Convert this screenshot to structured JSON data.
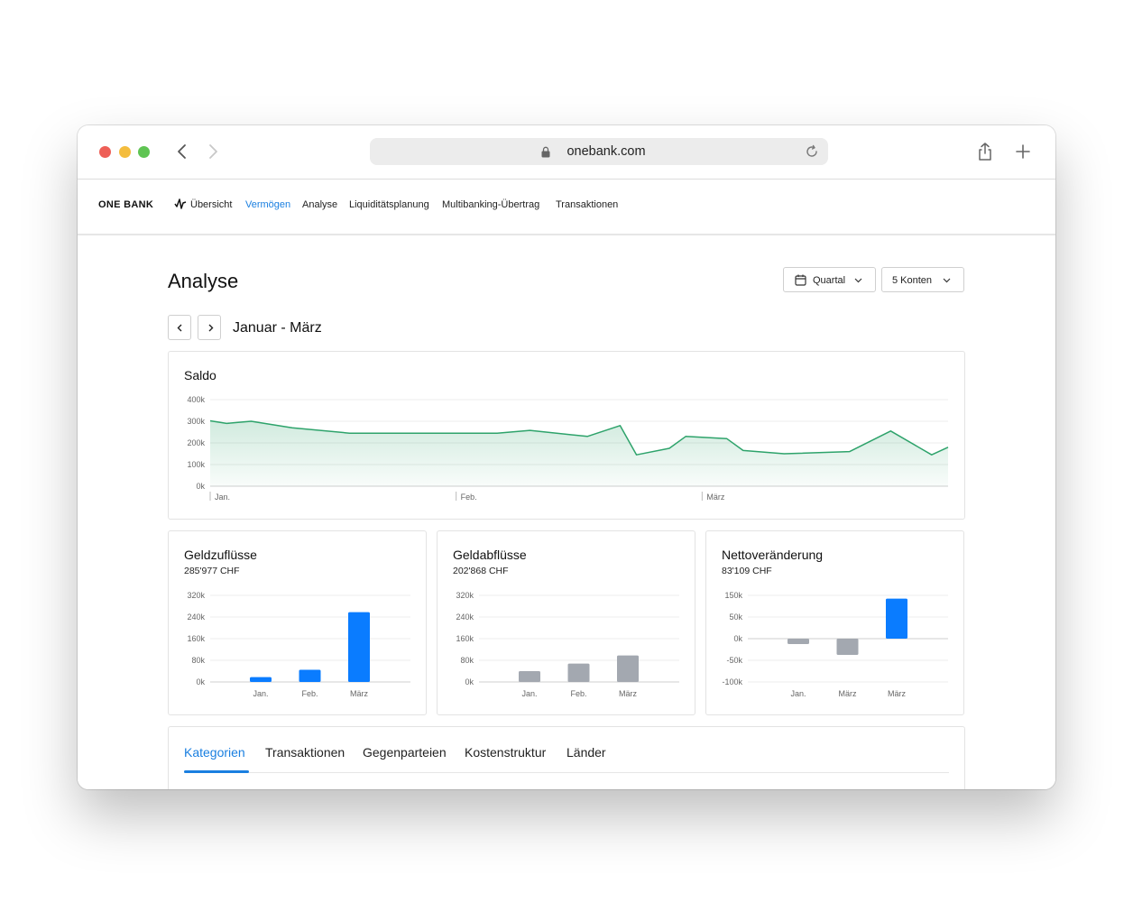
{
  "browser": {
    "url": "onebank.com"
  },
  "app": {
    "logo": "ONE BANK",
    "nav": [
      {
        "label": "Übersicht",
        "active": false
      },
      {
        "label": "Vermögen",
        "active": true
      },
      {
        "label": "Analyse",
        "active": false
      },
      {
        "label": "Liquiditätsplanung",
        "active": false
      },
      {
        "label": "Multibanking-Übertrag",
        "active": false
      },
      {
        "label": "Transaktionen",
        "active": false
      }
    ],
    "accent_color": "#1a7fe0"
  },
  "page": {
    "title": "Analyse",
    "period_dropdown": "Quartal",
    "accounts_dropdown": "5 Konten",
    "period_label": "Januar - März"
  },
  "tabs": [
    {
      "label": "Kategorien",
      "active": true
    },
    {
      "label": "Transaktionen",
      "active": false
    },
    {
      "label": "Gegenparteien",
      "active": false
    },
    {
      "label": "Kostenstruktur",
      "active": false
    },
    {
      "label": "Länder",
      "active": false
    }
  ],
  "chart_data": [
    {
      "type": "area",
      "title": "Saldo",
      "yticks": [
        "400k",
        "300k",
        "200k",
        "100k",
        "0k"
      ],
      "ylim": [
        0,
        400000
      ],
      "xticks": [
        "Jan.",
        "Feb.",
        "März"
      ],
      "xlim": [
        0,
        90
      ],
      "grid": true,
      "color": "#2ea36b",
      "x": [
        0,
        2,
        5,
        10,
        17,
        25,
        35,
        39,
        46,
        50,
        52,
        56,
        58,
        63,
        65,
        70,
        78,
        83,
        88,
        90
      ],
      "values": [
        302000,
        290000,
        300000,
        270000,
        245000,
        245000,
        245000,
        258000,
        230000,
        280000,
        145000,
        175000,
        230000,
        220000,
        165000,
        150000,
        160000,
        255000,
        145000,
        180000
      ]
    },
    {
      "type": "bar",
      "title": "Geldzuflüsse",
      "subtitle": "285'977 CHF",
      "categories": [
        "Jan.",
        "Feb.",
        "März"
      ],
      "values": [
        18000,
        45000,
        258000
      ],
      "yticks": [
        "320k",
        "240k",
        "160k",
        "80k",
        "0k"
      ],
      "ylim": [
        0,
        320000
      ],
      "color": "#0a7cff"
    },
    {
      "type": "bar",
      "title": "Geldabflüsse",
      "subtitle": "202'868 CHF",
      "categories": [
        "Jan.",
        "Feb.",
        "März"
      ],
      "values": [
        40000,
        68000,
        98000
      ],
      "yticks": [
        "320k",
        "240k",
        "160k",
        "80k",
        "0k"
      ],
      "ylim": [
        0,
        320000
      ],
      "color": "#a3a8b0"
    },
    {
      "type": "bar",
      "title": "Nettoveränderung",
      "subtitle": "83'109 CHF",
      "categories": [
        "Jan.",
        "März",
        "März"
      ],
      "values": [
        -25000,
        -75000,
        185000
      ],
      "yticks": [
        "150k",
        "50k",
        "0k",
        "-50k",
        "-100k"
      ],
      "ylim": [
        -200000,
        200000
      ],
      "colors": [
        "#a3a8b0",
        "#a3a8b0",
        "#0a7cff"
      ]
    }
  ]
}
